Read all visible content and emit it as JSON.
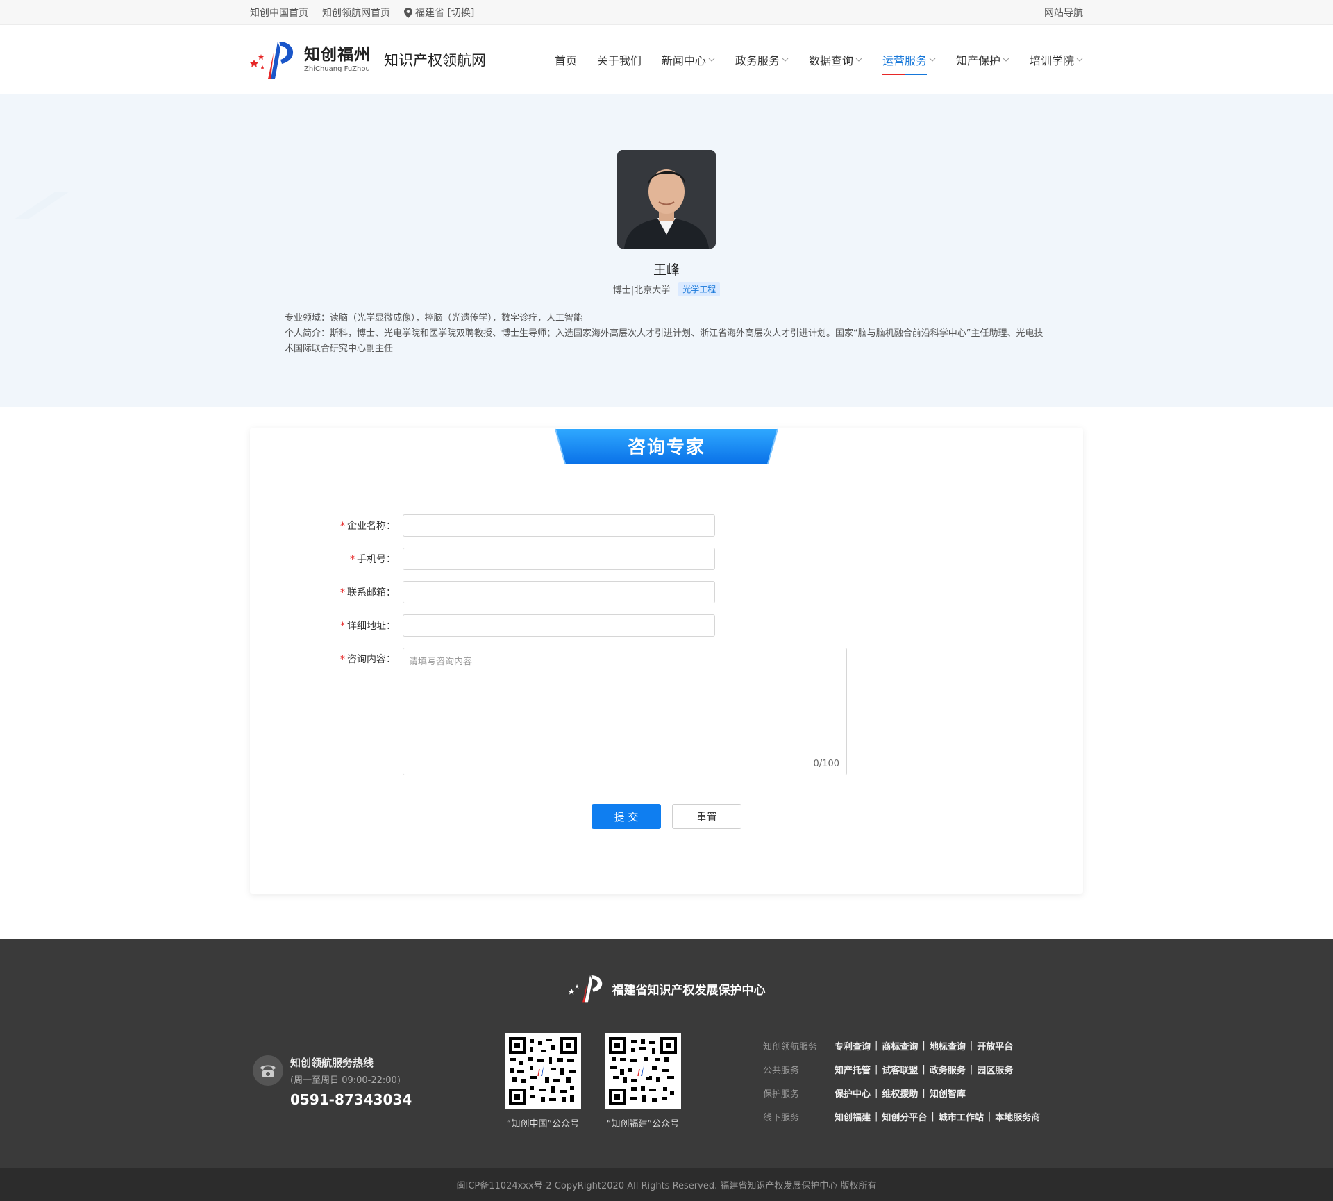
{
  "topbar": {
    "link1": "知创中国首页",
    "link2": "知创领航网首页",
    "location": "福建省 [切换]",
    "site_nav": "网站导航"
  },
  "header": {
    "brand_cn": "知创福州",
    "brand_en": "ZhiChuang FuZhou",
    "site_name": "知识产权领航网"
  },
  "nav": [
    {
      "label": "首页",
      "dropdown": false
    },
    {
      "label": "关于我们",
      "dropdown": false
    },
    {
      "label": "新闻中心",
      "dropdown": true
    },
    {
      "label": "政务服务",
      "dropdown": true
    },
    {
      "label": "数据查询",
      "dropdown": true
    },
    {
      "label": "运营服务",
      "dropdown": true,
      "active": true
    },
    {
      "label": "知产保护",
      "dropdown": true
    },
    {
      "label": "培训学院",
      "dropdown": true
    }
  ],
  "expert": {
    "name": "王峰",
    "degree": "博士|北京大学",
    "tag": "光学工程",
    "field": "专业领域：读脑（光学显微成像），控脑（光遗传学），数字诊疗，人工智能",
    "bio": "个人简介：斯科，博士、光电学院和医学院双聘教授、博士生导师；入选国家海外高层次人才引进计划、浙江省海外高层次人才引进计划。国家“脑与脑机融合前沿科学中心”主任助理、光电技术国际联合研究中心副主任"
  },
  "consult": {
    "title": "咨询专家",
    "fields": {
      "company": "企业名称：",
      "phone": "手机号：",
      "email": "联系邮箱：",
      "address": "详细地址：",
      "content": "咨询内容："
    },
    "required_mark": "*",
    "content_placeholder": "请填写咨询内容",
    "counter": "0/100",
    "submit": "提 交",
    "reset": "重置"
  },
  "footer": {
    "org": "福建省知识产权发展保护中心",
    "hotline_title": "知创领航服务热线",
    "hotline_time": "(周一至周日 09:00-22:00)",
    "hotline_number": "0591-87343034",
    "qr1_caption": "“知创中国”公众号",
    "qr2_caption": "“知创福建”公众号",
    "link_groups": [
      {
        "title": "知创领航服务",
        "items": [
          "专利查询",
          "商标查询",
          "地标查询",
          "开放平台"
        ]
      },
      {
        "title": "公共服务",
        "items": [
          "知产托管",
          "试客联盟",
          "政务服务",
          "园区服务"
        ]
      },
      {
        "title": "保护服务",
        "items": [
          "保护中心",
          "维权援助",
          "知创智库"
        ]
      },
      {
        "title": "线下服务",
        "items": [
          "知创福建",
          "知创分平台",
          "城市工作站",
          "本地服务商"
        ]
      }
    ],
    "copyright": "闽ICP备11024xxx号-2  CopyRight2020  All Rights Reserved.  福建省知识产权发展保护中心  版权所有"
  },
  "colors": {
    "primary": "#0f7ef0",
    "accent_red": "#e62828",
    "footer_bg": "#3a3a3a"
  }
}
